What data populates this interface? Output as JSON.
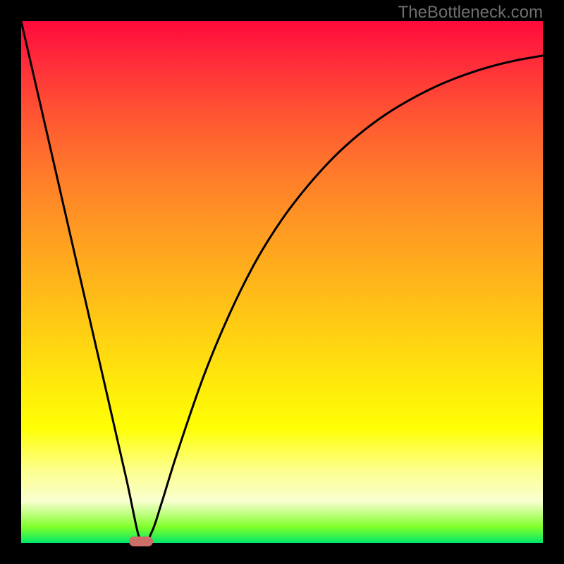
{
  "watermark": "TheBottleneck.com",
  "colors": {
    "frame": "#000000",
    "curve": "#000000",
    "marker": "#cc6f69",
    "gradient_stops": [
      "#ff0a3c",
      "#ff2d3a",
      "#ff5532",
      "#ff7d2a",
      "#ffa020",
      "#ffc017",
      "#ffe00e",
      "#ffff05",
      "#fdff8c",
      "#f9ffd0",
      "#7fff2a",
      "#00e868"
    ]
  },
  "chart_data": {
    "type": "line",
    "title": "",
    "xlabel": "",
    "ylabel": "",
    "xlim": [
      0,
      1
    ],
    "ylim": [
      0,
      1
    ],
    "legend": false,
    "grid": false,
    "series": [
      {
        "name": "bottleneck-curve",
        "x": [
          0.0,
          0.05,
          0.1,
          0.15,
          0.2,
          0.23,
          0.25,
          0.27,
          0.3,
          0.35,
          0.4,
          0.45,
          0.5,
          0.55,
          0.6,
          0.65,
          0.7,
          0.75,
          0.8,
          0.85,
          0.9,
          0.95,
          1.0
        ],
        "y": [
          1.0,
          0.783,
          0.565,
          0.348,
          0.13,
          0.0,
          0.02,
          0.079,
          0.175,
          0.32,
          0.44,
          0.54,
          0.62,
          0.685,
          0.74,
          0.785,
          0.822,
          0.852,
          0.877,
          0.897,
          0.913,
          0.925,
          0.934
        ]
      }
    ],
    "annotations": [
      {
        "name": "min-marker",
        "x": 0.23,
        "y": 0.0
      }
    ]
  }
}
